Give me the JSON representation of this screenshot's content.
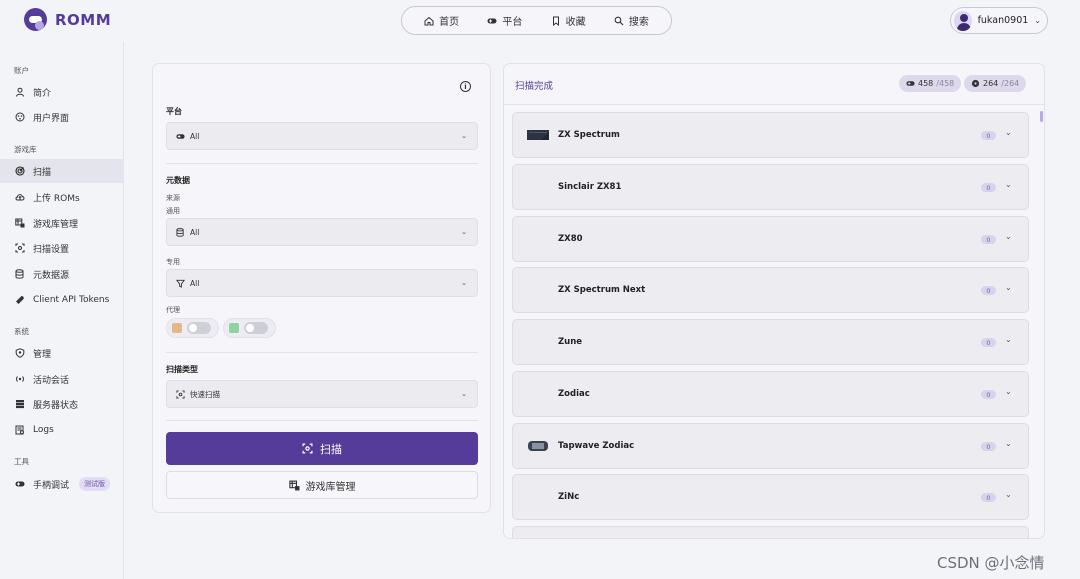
{
  "header": {
    "brand": "ROMM",
    "nav": [
      {
        "label": "首页",
        "icon": "home-icon"
      },
      {
        "label": "平台",
        "icon": "gamepad-icon"
      },
      {
        "label": "收藏",
        "icon": "bookmark-icon"
      },
      {
        "label": "搜索",
        "icon": "search-icon"
      }
    ],
    "user": "fukan0901"
  },
  "sidebar": {
    "sections": [
      {
        "title": "账户",
        "items": [
          {
            "label": "简介",
            "icon": "user-icon"
          },
          {
            "label": "用户界面",
            "icon": "palette-icon"
          }
        ]
      },
      {
        "title": "游戏库",
        "items": [
          {
            "label": "扫描",
            "icon": "radar-icon",
            "active": true
          },
          {
            "label": "上传 ROMs",
            "icon": "cloud-upload-icon"
          },
          {
            "label": "游戏库管理",
            "icon": "library-icon"
          },
          {
            "label": "扫描设置",
            "icon": "scan-settings-icon"
          },
          {
            "label": "元数据源",
            "icon": "database-icon"
          },
          {
            "label": "Client API Tokens",
            "icon": "wrench-icon"
          }
        ]
      },
      {
        "title": "系统",
        "items": [
          {
            "label": "管理",
            "icon": "shield-icon"
          },
          {
            "label": "活动会话",
            "icon": "broadcast-icon"
          },
          {
            "label": "服务器状态",
            "icon": "server-icon"
          },
          {
            "label": "Logs",
            "icon": "logs-icon"
          }
        ]
      },
      {
        "title": "工具",
        "items": [
          {
            "label": "手柄调试",
            "icon": "gamepad-icon",
            "badge": "测试版"
          }
        ]
      }
    ]
  },
  "scan_form": {
    "platform_label": "平台",
    "platform_value": "All",
    "metadata_label": "元数据",
    "source_label": "来源",
    "general_label": "通用",
    "general_value": "All",
    "specific_label": "专用",
    "specific_value": "All",
    "proxy_label": "代理",
    "scan_type_label": "扫描类型",
    "scan_type_value": "快速扫描",
    "scan_button": "扫描",
    "library_button": "游戏库管理"
  },
  "results": {
    "title": "扫描完成",
    "games_count": "458",
    "games_total": "/458",
    "platforms_count": "264",
    "platforms_total": "/264",
    "platforms": [
      {
        "name": "ZX Spectrum",
        "count": "0",
        "icon": "zx-spectrum-icon"
      },
      {
        "name": "Sinclair ZX81",
        "count": "0",
        "icon": ""
      },
      {
        "name": "ZX80",
        "count": "0",
        "icon": ""
      },
      {
        "name": "ZX Spectrum Next",
        "count": "0",
        "icon": ""
      },
      {
        "name": "Zune",
        "count": "0",
        "icon": ""
      },
      {
        "name": "Zodiac",
        "count": "0",
        "icon": ""
      },
      {
        "name": "Tapwave Zodiac",
        "count": "0",
        "icon": "tapwave-zodiac-icon"
      },
      {
        "name": "ZiNc",
        "count": "0",
        "icon": ""
      }
    ]
  },
  "watermark": "CSDN @小念情"
}
